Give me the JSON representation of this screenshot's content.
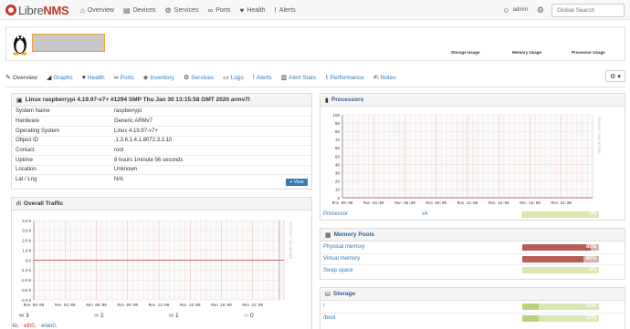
{
  "nav": {
    "brand_main": "Libre",
    "brand_accent": "NMS",
    "items": [
      {
        "label": "Overview",
        "icon": "home-icon",
        "glyph": "⌂"
      },
      {
        "label": "Devices",
        "icon": "server-icon",
        "glyph": "▤"
      },
      {
        "label": "Services",
        "icon": "cogs-icon",
        "glyph": "⚙"
      },
      {
        "label": "Ports",
        "icon": "link-icon",
        "glyph": "∞"
      },
      {
        "label": "Health",
        "icon": "heartbeat-icon",
        "glyph": "♥"
      },
      {
        "label": "Alerts",
        "icon": "exclamation-circle-icon",
        "glyph": "!"
      }
    ],
    "user": "admin",
    "search_placeholder": "Global Search"
  },
  "device_header": {
    "usage_labels": [
      "Storage Usage",
      "Memory Usage",
      "Processor Usage"
    ]
  },
  "tabs": [
    {
      "label": "Overview",
      "icon": "lightbulb-icon",
      "glyph": "✎",
      "active": true
    },
    {
      "label": "Graphs",
      "icon": "area-chart-icon",
      "glyph": "◢",
      "active": false
    },
    {
      "label": "Health",
      "icon": "heartbeat-icon",
      "glyph": "♥",
      "active": false
    },
    {
      "label": "Ports",
      "icon": "link-icon",
      "glyph": "∞",
      "active": false
    },
    {
      "label": "Inventory",
      "icon": "cube-icon",
      "glyph": "◈",
      "active": false
    },
    {
      "label": "Services",
      "icon": "cogs-icon",
      "glyph": "⚙",
      "active": false
    },
    {
      "label": "Logs",
      "icon": "file-icon",
      "glyph": "▭",
      "active": false
    },
    {
      "label": "Alerts",
      "icon": "exclamation-circle-icon",
      "glyph": "!",
      "active": false
    },
    {
      "label": "Alert Stats",
      "icon": "bar-chart-icon",
      "glyph": "▥",
      "active": false
    },
    {
      "label": "Performance",
      "icon": "line-chart-icon",
      "glyph": "⌇",
      "active": false
    },
    {
      "label": "Notes",
      "icon": "sticky-note-icon",
      "glyph": "✍",
      "active": false
    }
  ],
  "overview": {
    "title": "Linux raspberrypi 4.19.97-v7+ #1294 SMP Thu Jan 30 13:15:58 GMT 2020 armv7l",
    "rows": [
      {
        "k": "System Name",
        "v": "raspberrypi"
      },
      {
        "k": "Hardware",
        "v": "Generic ARMv7"
      },
      {
        "k": "Operating System",
        "v": "Linux 4.19.97-v7+"
      },
      {
        "k": "Object ID",
        "v": ".1.3.6.1.4.1.8072.3.2.10"
      },
      {
        "k": "Contact",
        "v": "root"
      },
      {
        "k": "Uptime",
        "v": "8 hours 1minute 56 seconds"
      },
      {
        "k": "Location",
        "v": "Unknown"
      },
      {
        "k": "Lat / Lng",
        "v": "N/A"
      }
    ],
    "view_button": "View"
  },
  "traffic": {
    "title": "Overall Traffic",
    "y_ticks": [
      "4.0 k",
      "3.0 k",
      "2.0 k",
      "1.0 k",
      "0.0",
      "-1.0 k",
      "-2.0 k",
      "-3.0 k",
      "-4.0 k"
    ],
    "x_ticks": [
      "Mon 00:00",
      "Mon 03:00",
      "Mon 06:00",
      "Mon 09:00",
      "Mon 12:00",
      "Mon 15:00",
      "Mon 18:00",
      "Mon 21:00"
    ],
    "watermark": "RRDTOOL / TOBI OETIKER",
    "ports": [
      {
        "icon": "link-icon",
        "glyph": "∞",
        "count": "3",
        "color": "#333"
      },
      {
        "icon": "link-up-icon",
        "glyph": "∞",
        "count": "2",
        "color": "#2a6db0"
      },
      {
        "icon": "link-down-icon",
        "glyph": "∞",
        "count": "1",
        "color": "#c0392b"
      },
      {
        "icon": "link-disabled-icon",
        "glyph": "∞",
        "count": "0",
        "color": "#999"
      }
    ],
    "iface_prefix": "lo,",
    "iface_links": [
      "eth0,",
      "wlan0,"
    ]
  },
  "processors": {
    "title": "Processors",
    "y_ticks": [
      "100",
      "90",
      "80",
      "70",
      "60",
      "50",
      "40",
      "30",
      "20",
      "10",
      "0"
    ],
    "x_ticks": [
      "Mon 00:00",
      "Mon 03:00",
      "Mon 06:00",
      "Mon 09:00",
      "Mon 12:00",
      "Mon 15:00",
      "Mon 18:00",
      "Mon 21:00"
    ],
    "watermark": "RRDTOOL / TOBI OETIKER",
    "rows": [
      {
        "label": "Processor",
        "mid": "x4",
        "percent_text": "1%",
        "fill": 0.01
      }
    ]
  },
  "memory": {
    "title": "Memory Pools",
    "rows": [
      {
        "label": "Physical memory",
        "percent_text": "89%",
        "fill": 0.89
      },
      {
        "label": "Virtual memory",
        "percent_text": "80%",
        "fill": 0.8
      },
      {
        "label": "Swap space",
        "percent_text": "0%",
        "fill": 0.0
      }
    ]
  },
  "storage": {
    "title": "Storage",
    "rows": [
      {
        "label": "/",
        "percent_text": "21%",
        "fill": 0.21
      },
      {
        "label": "/boot",
        "percent_text": "21%",
        "fill": 0.21
      }
    ]
  },
  "colors": {
    "bar_green": "#b9d27a",
    "bar_green_light": "#d9e7b3",
    "bar_red": "#b75c55",
    "graph_line": "#e7b0a8",
    "axis_red": "#b04040",
    "link_blue": "#337ab7"
  }
}
